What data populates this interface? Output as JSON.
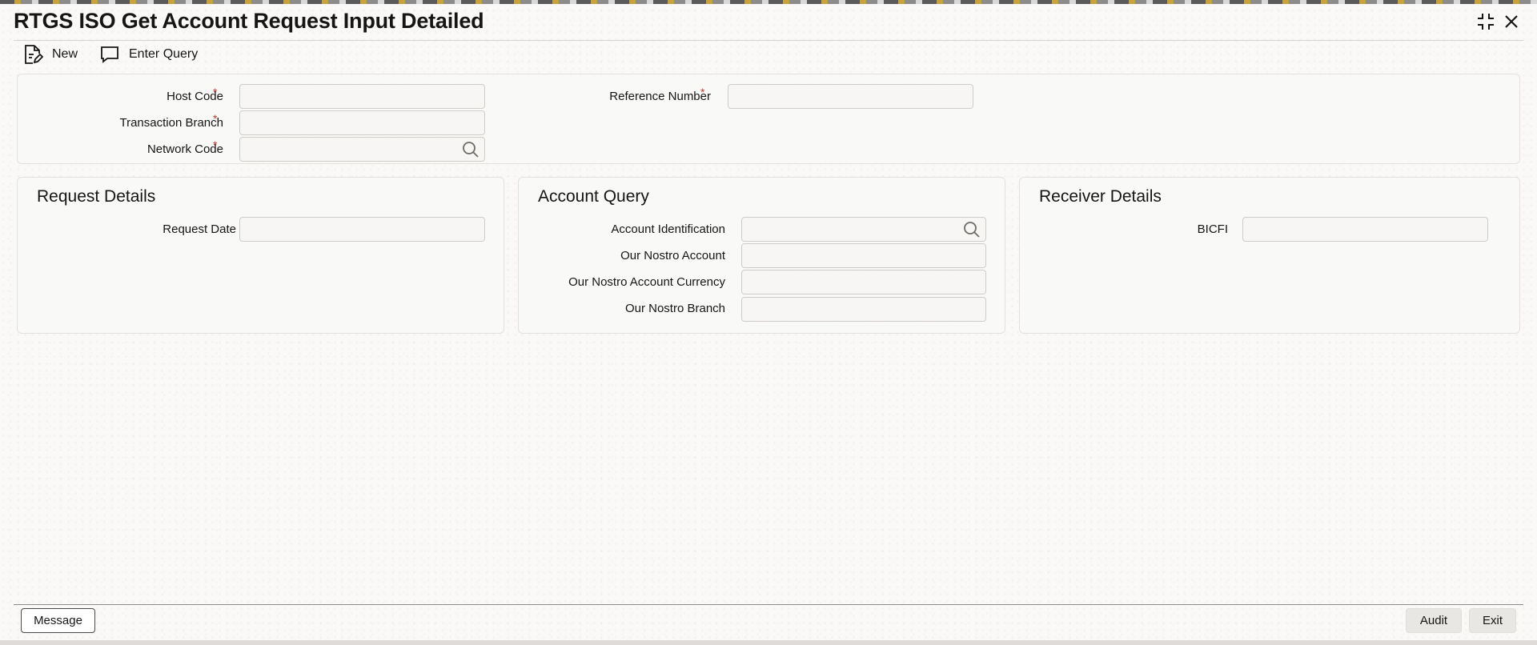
{
  "window": {
    "title": "RTGS ISO Get Account Request Input Detailed",
    "controls": [
      "expand-icon",
      "close-icon"
    ]
  },
  "toolbar": {
    "new_label": "New",
    "enter_query_label": "Enter Query"
  },
  "header_form": {
    "host_code": {
      "label": "Host Code",
      "required": "*",
      "value": ""
    },
    "transaction_branch": {
      "label": "Transaction Branch",
      "required": "*",
      "value": ""
    },
    "network_code": {
      "label": "Network Code",
      "required": "*",
      "value": ""
    },
    "reference_number": {
      "label": "Reference Number",
      "required": "*",
      "value": ""
    }
  },
  "request_details": {
    "title": "Request Details",
    "request_date": {
      "label": "Request Date",
      "value": ""
    }
  },
  "account_query": {
    "title": "Account Query",
    "account_identification": {
      "label": "Account Identification",
      "value": ""
    },
    "our_nostro_account": {
      "label": "Our Nostro Account",
      "value": ""
    },
    "our_nostro_account_currency": {
      "label": "Our Nostro Account Currency",
      "value": ""
    },
    "our_nostro_branch": {
      "label": "Our Nostro Branch",
      "value": ""
    }
  },
  "receiver_details": {
    "title": "Receiver Details",
    "bicfi": {
      "label": "BICFI",
      "value": ""
    }
  },
  "footer": {
    "message_label": "Message",
    "audit_label": "Audit",
    "exit_label": "Exit"
  },
  "colors": {
    "required_marker": "#c0392b",
    "panel_background": "#f9f8f6",
    "field_border": "#cfccc8"
  }
}
